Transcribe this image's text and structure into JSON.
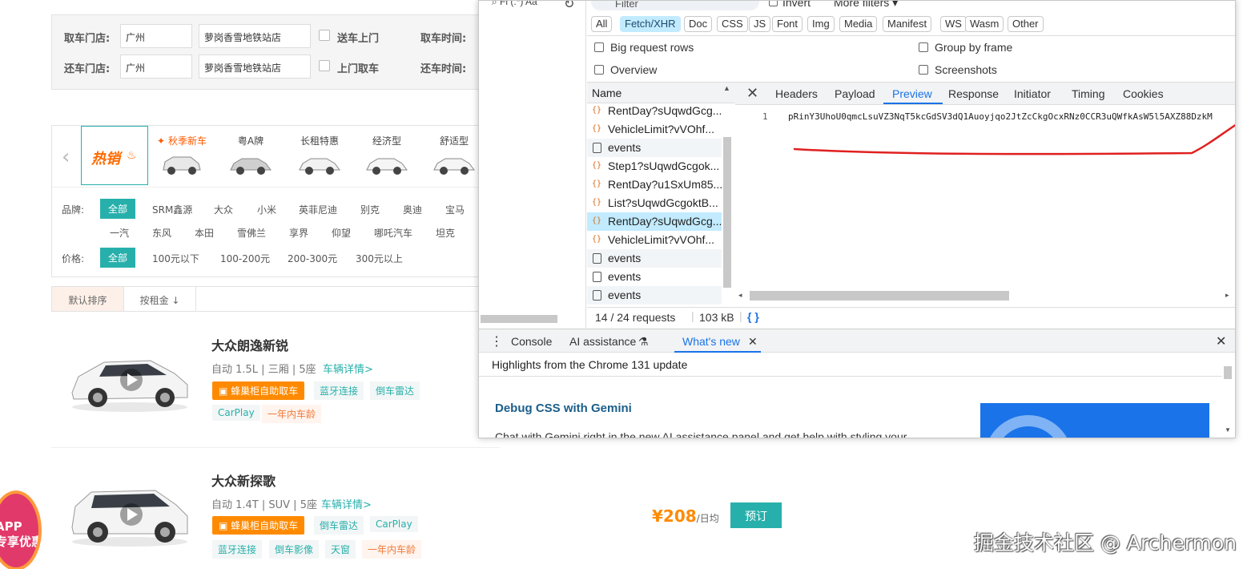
{
  "search": {
    "pickup_store_label": "取车门店:",
    "pickup_city": "广州",
    "pickup_station": "萝岗香雪地铁站店",
    "delivery_label": "送车上门",
    "pickup_time_label": "取车时间:",
    "return_store_label": "还车门店:",
    "return_city": "广州",
    "return_station": "萝岗香雪地铁站店",
    "door_pickup_label": "上门取车",
    "return_time_label": "还车时间:"
  },
  "categories": {
    "hot_label": "热销",
    "items": [
      {
        "label": "秋季新车",
        "highlight": true,
        "icon": "maple-leaf-icon"
      },
      {
        "label": "粤A牌",
        "highlight": false
      },
      {
        "label": "长租特惠",
        "highlight": false
      },
      {
        "label": "经济型",
        "highlight": false
      },
      {
        "label": "舒适型",
        "highlight": false
      }
    ]
  },
  "filters": {
    "brand_label": "品牌:",
    "brand_selected": "全部",
    "brands_row1": [
      "SRM鑫源",
      "大众",
      "小米",
      "英菲尼迪",
      "别克",
      "奥迪",
      "宝马"
    ],
    "brands_row2": [
      "一汽",
      "东风",
      "本田",
      "雪佛兰",
      "享界",
      "仰望",
      "哪吒汽车",
      "坦克"
    ],
    "price_label": "价格:",
    "price_selected": "全部",
    "prices": [
      "100元以下",
      "100-200元",
      "200-300元",
      "300元以上"
    ]
  },
  "sort": {
    "default_label": "默认排序",
    "rent_label": "按租金 ↓"
  },
  "cars": [
    {
      "name": "大众朗逸新锐",
      "spec": "自动 1.5L | 三厢 | 5座",
      "detail_link": "车辆详情>",
      "self_pickup_tag": "蜂巢柜自助取车",
      "tags_row1": [
        "蓝牙连接",
        "倒车雷达"
      ],
      "tags_row2": [
        "CarPlay",
        "一年内车龄"
      ]
    },
    {
      "name": "大众新探歌",
      "spec": "自动 1.4T | SUV | 5座",
      "detail_link": "车辆详情>",
      "self_pickup_tag": "蜂巢柜自助取车",
      "tags_row1": [
        "倒车雷达",
        "CarPlay"
      ],
      "tags_row2": [
        "蓝牙连接",
        "倒车影像",
        "天窗",
        "一年内车龄"
      ],
      "price": "¥208",
      "price_unit": "/日均",
      "book_label": "预订"
    }
  ],
  "app_badge": "APP\n专享优惠",
  "watermark": "掘金技术社区 @ Archermon",
  "devtools": {
    "filter_placeholder": "Filter",
    "invert_label": "Invert",
    "more_filters_label": "More filters ▾",
    "types": [
      "All",
      "Fetch/XHR",
      "Doc",
      "CSS",
      "JS",
      "Font",
      "Img",
      "Media",
      "Manifest",
      "WS",
      "Wasm",
      "Other"
    ],
    "active_type": "Fetch/XHR",
    "options": {
      "big_rows": "Big request rows",
      "overview": "Overview",
      "group_by_frame": "Group by frame",
      "screenshots": "Screenshots"
    },
    "name_header": "Name",
    "requests": [
      {
        "name": "RentDay?sUqwdGcg...",
        "kind": "xhr"
      },
      {
        "name": "VehicleLimit?vVOhf...",
        "kind": "xhr"
      },
      {
        "name": "events",
        "kind": "doc"
      },
      {
        "name": "Step1?sUqwdGcgok...",
        "kind": "xhr"
      },
      {
        "name": "RentDay?u1SxUm85...",
        "kind": "xhr"
      },
      {
        "name": "List?sUqwdGcgoktB...",
        "kind": "xhr"
      },
      {
        "name": "RentDay?sUqwdGcg...",
        "kind": "xhr",
        "selected": true
      },
      {
        "name": "VehicleLimit?vVOhf...",
        "kind": "xhr"
      },
      {
        "name": "events",
        "kind": "doc"
      },
      {
        "name": "events",
        "kind": "doc"
      },
      {
        "name": "events",
        "kind": "doc"
      }
    ],
    "detail_tabs": [
      "Headers",
      "Payload",
      "Preview",
      "Response",
      "Initiator",
      "Timing",
      "Cookies"
    ],
    "active_detail_tab": "Preview",
    "preview_line_number": "1",
    "preview_text": "pRinY3UhoU0qmcLsuVZ3NqT5kcGdSV3dQ1Auoyjqo2JtZcCkgOcxRNz0CCR3uQWfkAsW5l5AXZ88DzkM",
    "status_requests": "14 / 24 requests",
    "status_size": "103 kB",
    "drawer": {
      "console": "Console",
      "ai": "AI assistance",
      "whats_new": "What's new",
      "highlights": "Highlights from the Chrome 131 update",
      "gemini_title": "Debug CSS with Gemini",
      "gemini_sub": "Chat with Gemini right in the new AI assistance panel and get help with styling your"
    }
  },
  "colors": {
    "teal": "#27b0ab",
    "orange": "#ff8a00",
    "devtools_blue": "#1a73e8",
    "annotation_red": "#e02020"
  }
}
